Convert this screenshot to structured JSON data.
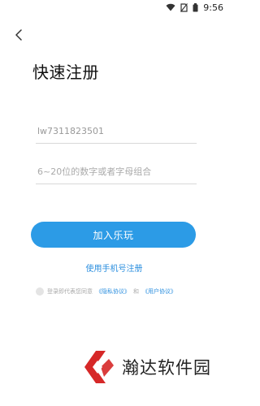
{
  "status_bar": {
    "time": "9:56"
  },
  "header": {
    "title": "快速注册"
  },
  "form": {
    "account_value": "lw7311823501",
    "password_placeholder": "6~20位的数字或者字母组合"
  },
  "actions": {
    "join_label": "加入乐玩",
    "phone_register_label": "使用手机号注册"
  },
  "agreement": {
    "prefix": "登录即代表您同意",
    "privacy_link": "《隐私协议》",
    "and": "和",
    "user_link": "《用户协议》"
  },
  "watermark": {
    "text": "瀚达软件园"
  },
  "colors": {
    "accent": "#2c9be6",
    "link": "#2c8fdf"
  }
}
